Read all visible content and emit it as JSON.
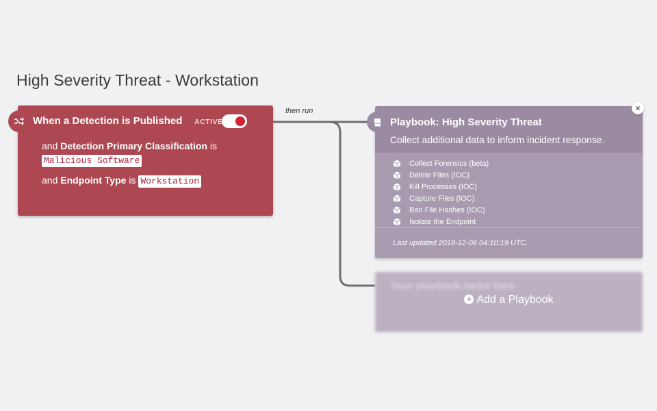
{
  "page": {
    "title": "High Severity Threat - Workstation"
  },
  "trigger": {
    "title": "When a Detection is Published",
    "status_label": "ACTIVE",
    "active": true,
    "conditions": [
      {
        "prefix": "and",
        "field": "Detection Primary Classification",
        "op": "is",
        "value": "Malicious Software"
      },
      {
        "prefix": "and",
        "field": "Endpoint Type",
        "op": "is",
        "value": "Workstation"
      }
    ]
  },
  "connector": {
    "label": "then run"
  },
  "playbook": {
    "title": "Playbook: High Severity Threat",
    "description": "Collect additional data to inform incident response.",
    "actions": [
      "Collect Forensics (beta)",
      "Delete Files (IOC)",
      "Kill Processes (IOC)",
      "Capture Files (IOC)",
      "Ban File Hashes (IOC)",
      "Isolate the Endpoint"
    ],
    "last_updated": "Last updated 2018-12-06 04:10:19 UTC.",
    "close_icon": "×"
  },
  "add_playbook": {
    "label": "Add a Playbook",
    "placeholder_title": "Your playbook name here"
  },
  "colors": {
    "trigger_bg": "#ad4751",
    "playbook_bg": "#a89bb0",
    "toggle_on": "#d32231"
  }
}
